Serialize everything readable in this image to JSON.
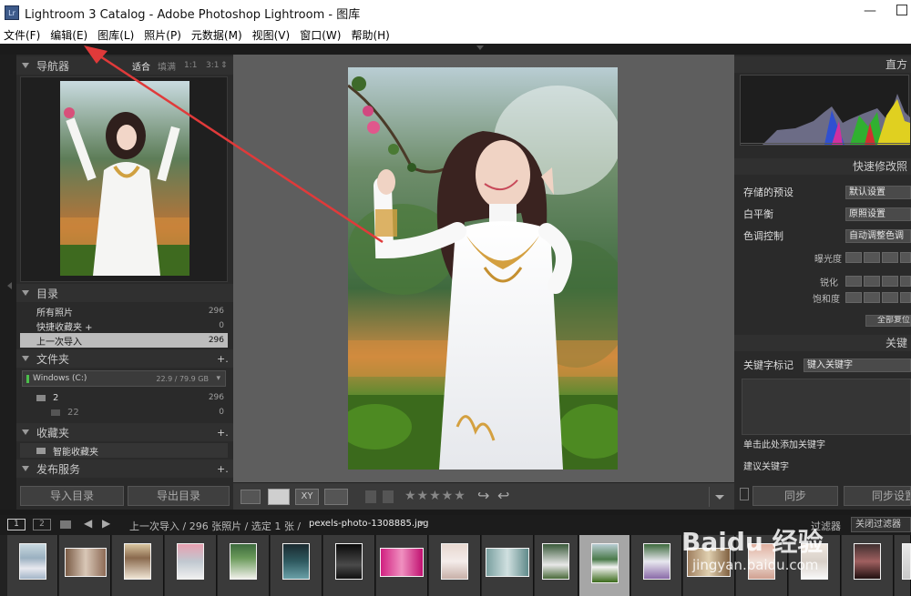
{
  "window": {
    "title": "Lightroom 3 Catalog - Adobe Photoshop Lightroom - 图库",
    "app_icon": "Lr",
    "minimize": "—"
  },
  "menu": [
    "文件(F)",
    "编辑(E)",
    "图库(L)",
    "照片(P)",
    "元数据(M)",
    "视图(V)",
    "窗口(W)",
    "帮助(H)"
  ],
  "navigator": {
    "title": "导航器",
    "zoom_options": [
      "适合",
      "填满",
      "1:1",
      "3:1"
    ],
    "zoom_more": "⇕"
  },
  "catalog": {
    "title": "目录",
    "items": [
      {
        "label": "所有照片",
        "count": "296"
      },
      {
        "label": "快捷收藏夹 +",
        "count": "0"
      },
      {
        "label": "上一次导入",
        "count": "296"
      }
    ]
  },
  "folders": {
    "title": "文件夹",
    "add": "+.",
    "volume": {
      "name": "Windows (C:)",
      "space": "22.9 / 79.9 GB",
      "menu": "▾"
    },
    "items": [
      {
        "label": "2",
        "count": "296"
      },
      {
        "label": "22",
        "count": "0"
      }
    ]
  },
  "collections": {
    "title": "收藏夹",
    "add": "+.",
    "items": [
      {
        "label": "智能收藏夹"
      }
    ]
  },
  "publish": {
    "title": "发布服务",
    "add": "+."
  },
  "left_buttons": {
    "import": "导入目录",
    "export": "导出目录"
  },
  "histogram": {
    "title": "直方"
  },
  "quick_develop": {
    "title": "快速修改照",
    "saved_preset_label": "存储的预设",
    "saved_preset_value": "默认设置",
    "wb_label": "白平衡",
    "wb_value": "原照设置",
    "tone_label": "色调控制",
    "auto_tone": "自动调整色调",
    "exposure": "曝光度",
    "sharpen": "锐化",
    "saturation": "饱和度",
    "reset_all": "全部复位"
  },
  "keywording": {
    "title": "关键",
    "tags_label": "关键字标记",
    "tags_value": "键入关键字",
    "add_hint": "单击此处添加关键字",
    "suggested": "建议关键字"
  },
  "right_buttons": {
    "sync": "同步",
    "sync_settings": "同步设置"
  },
  "toolbar": {
    "stars": "★★★★★",
    "xy": "XY"
  },
  "filmstrip_bar": {
    "page1": "1",
    "page2": "2",
    "path": "上一次导入 / 296 张照片 / 选定 1 张 /",
    "filename": "pexels-photo-1308885.jpg",
    "dropdown": "▾",
    "filter_label": "过滤器",
    "filter_value": "关闭过滤器"
  },
  "watermark": {
    "brand": "Baidu 经验",
    "url": "jingyan.baidu.com"
  },
  "colors": {
    "accent_arrow": "#e03a3a",
    "panel_bg": "#2a2a2a",
    "selection": "#bcbcbc"
  }
}
